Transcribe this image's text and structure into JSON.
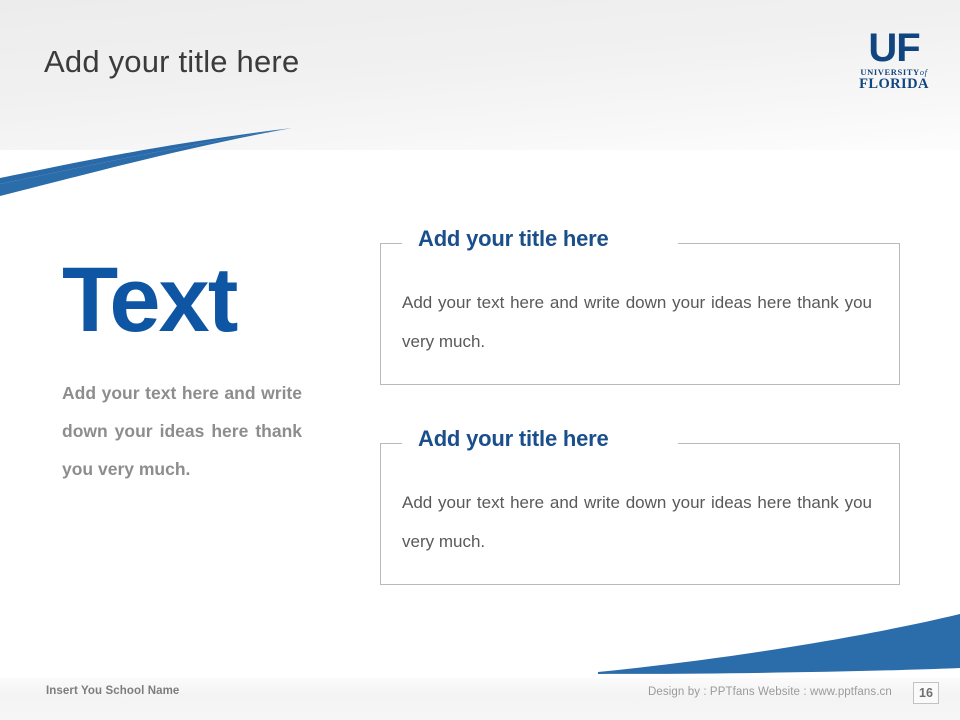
{
  "slide": {
    "title": "Add your title here",
    "page_number": "16",
    "accent_blue": "#0e56a4",
    "title_blue": "#1a4f8b",
    "title_gray": "#3b3b3b",
    "body_gray": "#595959",
    "muted_gray": "#8d8d8d"
  },
  "logo": {
    "mark": "UF",
    "university_word": "UNIVERSITY",
    "of_word": "of",
    "state_word": "FLORIDA",
    "alt": "University of Florida logo"
  },
  "left": {
    "headline": "Text",
    "paragraph": "Add your text here and write down your ideas here thank you very much."
  },
  "boxes": [
    {
      "title": "Add your title here",
      "body": "Add your text here and write down your ideas here thank you very much."
    },
    {
      "title": "Add your title here",
      "body": "Add your text here and write down your ideas here thank you very much."
    }
  ],
  "footer": {
    "school_placeholder": "Insert You School Name",
    "credit": "Design by : PPTfans  Website : www.pptfans.cn"
  }
}
